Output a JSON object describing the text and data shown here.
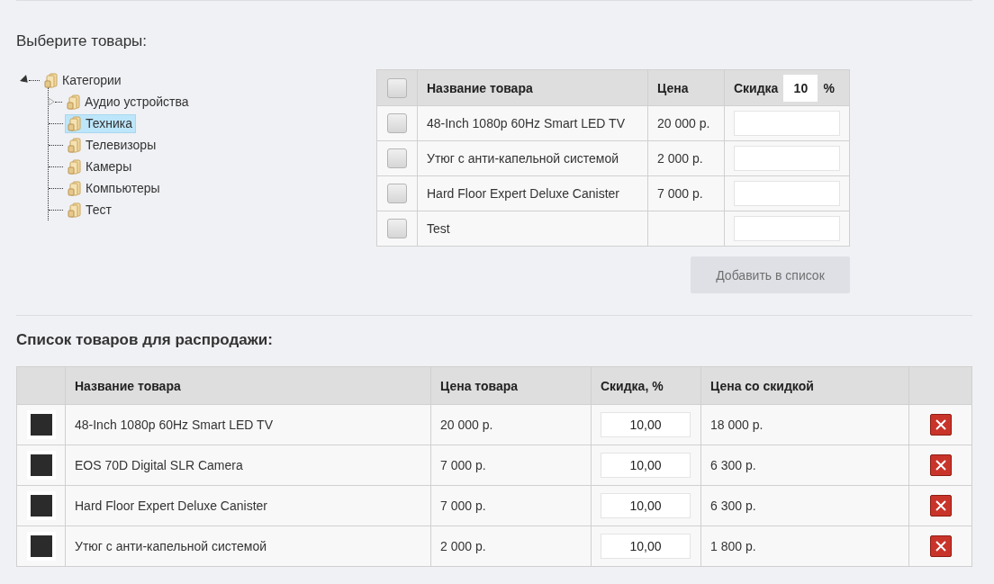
{
  "select_heading": "Выберите товары:",
  "tree": {
    "label": "Категории",
    "expanded": true,
    "selected": false,
    "children": [
      {
        "label": "Аудио устройства",
        "kind": "branch",
        "expanded": false,
        "selected": false
      },
      {
        "label": "Техника",
        "kind": "leaf",
        "selected": true
      },
      {
        "label": "Телевизоры",
        "kind": "leaf",
        "selected": false
      },
      {
        "label": "Камеры",
        "kind": "leaf",
        "selected": false
      },
      {
        "label": "Компьютеры",
        "kind": "leaf",
        "selected": false
      },
      {
        "label": "Тест",
        "kind": "leaf",
        "selected": false
      }
    ]
  },
  "products_table": {
    "header_checked": false,
    "columns": [
      "Название товара",
      "Цена"
    ],
    "discount_header": {
      "label": "Скидка",
      "value": "10",
      "unit": "%"
    },
    "rows": [
      {
        "checked": false,
        "name": "48-Inch 1080p 60Hz Smart LED TV",
        "price": "20 000 р."
      },
      {
        "checked": false,
        "name": "Утюг с анти-капельной системой",
        "price": "2 000 р."
      },
      {
        "checked": false,
        "name": "Hard Floor Expert Deluxe Canister",
        "price": "7 000 р."
      },
      {
        "checked": false,
        "name": "Test",
        "price": null
      }
    ]
  },
  "add_button": {
    "label": "Добавить в список",
    "disabled": true
  },
  "sale_heading": "Список товаров для распродажи:",
  "sale_table": {
    "columns": [
      "Название товара",
      "Цена товара",
      "Скидка, %",
      "Цена со скидкой"
    ],
    "rows": [
      {
        "name": "48-Inch 1080p 60Hz Smart LED TV",
        "price": "20 000 р.",
        "discount": "10,00",
        "final_price": "18 000 р."
      },
      {
        "name": "EOS 70D Digital SLR Camera",
        "price": "7 000 р.",
        "discount": "10,00",
        "final_price": "6 300 р."
      },
      {
        "name": "Hard Floor Expert Deluxe Canister",
        "price": "7 000 р.",
        "discount": "10,00",
        "final_price": "6 300 р."
      },
      {
        "name": "Утюг с анти-капельной системой",
        "price": "2 000 р.",
        "discount": "10,00",
        "final_price": "1 800 р."
      }
    ]
  }
}
